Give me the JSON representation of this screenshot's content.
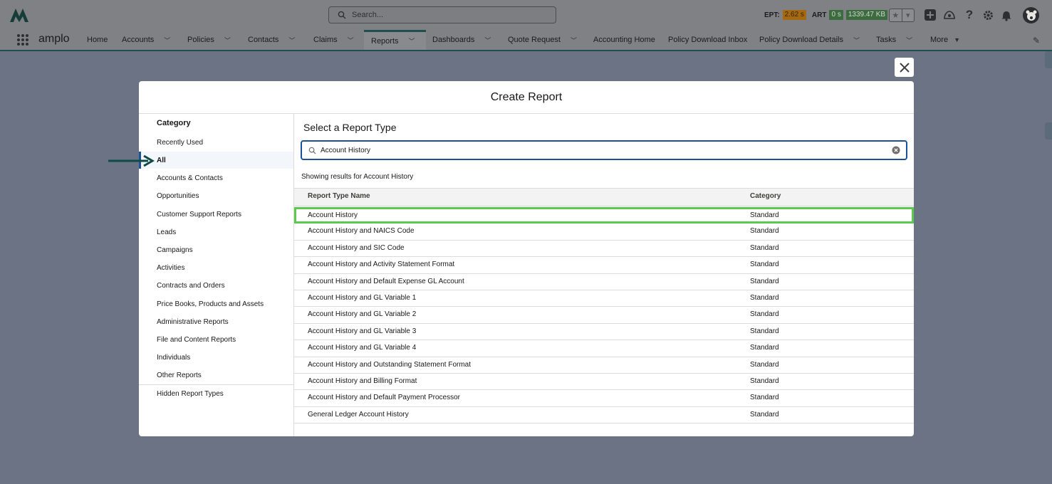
{
  "header": {
    "search_placeholder": "Search...",
    "metrics": {
      "ept_label": "EPT:",
      "ept_value": "2.62 s",
      "art_label": "ART",
      "art_value": "0 s",
      "size_value": "1339.47 KB"
    }
  },
  "nav": {
    "app_name": "amplo",
    "items": [
      {
        "label": "Home"
      },
      {
        "label": "Accounts"
      },
      {
        "label": "Policies"
      },
      {
        "label": "Contacts"
      },
      {
        "label": "Claims"
      },
      {
        "label": "Reports"
      },
      {
        "label": "Dashboards"
      },
      {
        "label": "Quote Request"
      },
      {
        "label": "Accounting Home"
      },
      {
        "label": "Policy Download Inbox"
      },
      {
        "label": "Policy Download Details"
      },
      {
        "label": "Tasks"
      },
      {
        "label": "More"
      }
    ]
  },
  "modal": {
    "title": "Create Report",
    "sidebar": {
      "title": "Category",
      "items": [
        "Recently Used",
        "All",
        "Accounts & Contacts",
        "Opportunities",
        "Customer Support Reports",
        "Leads",
        "Campaigns",
        "Activities",
        "Contracts and Orders",
        "Price Books, Products and Assets",
        "Administrative Reports",
        "File and Content Reports",
        "Individuals",
        "Other Reports"
      ],
      "selected": "All",
      "hidden_types": "Hidden Report Types"
    },
    "main": {
      "title": "Select a Report Type",
      "search_value": "Account History",
      "results_note": "Showing results for Account History",
      "columns": {
        "name": "Report Type Name",
        "category": "Category"
      },
      "rows": [
        {
          "name": "Account History",
          "category": "Standard"
        },
        {
          "name": "Account History and NAICS Code",
          "category": "Standard"
        },
        {
          "name": "Account History and SIC Code",
          "category": "Standard"
        },
        {
          "name": "Account History and Activity Statement Format",
          "category": "Standard"
        },
        {
          "name": "Account History and Default Expense GL Account",
          "category": "Standard"
        },
        {
          "name": "Account History and GL Variable 1",
          "category": "Standard"
        },
        {
          "name": "Account History and GL Variable 2",
          "category": "Standard"
        },
        {
          "name": "Account History and GL Variable 3",
          "category": "Standard"
        },
        {
          "name": "Account History and GL Variable 4",
          "category": "Standard"
        },
        {
          "name": "Account History and Outstanding Statement Format",
          "category": "Standard"
        },
        {
          "name": "Account History and Billing Format",
          "category": "Standard"
        },
        {
          "name": "Account History and Default Payment Processor",
          "category": "Standard"
        },
        {
          "name": "General Ledger Account History",
          "category": "Standard"
        }
      ]
    }
  },
  "colors": {
    "accent": "#1b5297",
    "highlight": "#5bc850",
    "arrow": "#0f4a45"
  }
}
